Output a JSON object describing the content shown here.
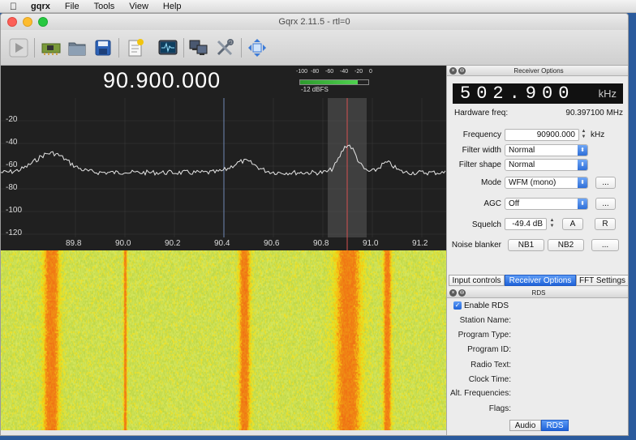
{
  "menubar": {
    "apple": "",
    "app": "gqrx",
    "items": [
      "File",
      "Tools",
      "View",
      "Help"
    ]
  },
  "window": {
    "title": "Gqrx 2.11.5 - rtl=0"
  },
  "display": {
    "center_frequency": "90.900.000",
    "meter_ticks": [
      "-100",
      "-80",
      "-60",
      "-40",
      "-20",
      "0"
    ],
    "meter_value": "-12 dBFS",
    "meter_level": 0.84,
    "y_ticks": [
      "-20",
      "-40",
      "-60",
      "-80",
      "-100",
      "-120"
    ],
    "x_ticks": [
      "89.8",
      "90.0",
      "90.2",
      "90.4",
      "90.6",
      "90.8",
      "91.0",
      "91.2"
    ]
  },
  "receiver_options": {
    "header": "Receiver Options",
    "lcd_digits": "502.900",
    "lcd_unit": "kHz",
    "hw_freq_label": "Hardware freq:",
    "hw_freq_value": "90.397100 MHz",
    "frequency_label": "Frequency",
    "frequency_value": "90900.000",
    "frequency_unit": "kHz",
    "filter_width_label": "Filter width",
    "filter_width_value": "Normal",
    "filter_shape_label": "Filter shape",
    "filter_shape_value": "Normal",
    "mode_label": "Mode",
    "mode_value": "WFM (mono)",
    "agc_label": "AGC",
    "agc_value": "Off",
    "squelch_label": "Squelch",
    "squelch_value": "-49.4 dB",
    "squelch_a": "A",
    "squelch_r": "R",
    "noise_label": "Noise blanker",
    "nb1": "NB1",
    "nb2": "NB2",
    "more": "..."
  },
  "tabs": [
    "Input controls",
    "Receiver Options",
    "FFT Settings"
  ],
  "rds": {
    "header": "RDS",
    "enable_label": "Enable RDS",
    "enabled": true,
    "fields": [
      "Station Name:",
      "Program Type:",
      "Program ID:",
      "Radio Text:",
      "Clock Time:",
      "Alt. Frequencies:",
      "Flags:"
    ]
  },
  "bottom_tabs": [
    "Audio",
    "RDS"
  ]
}
